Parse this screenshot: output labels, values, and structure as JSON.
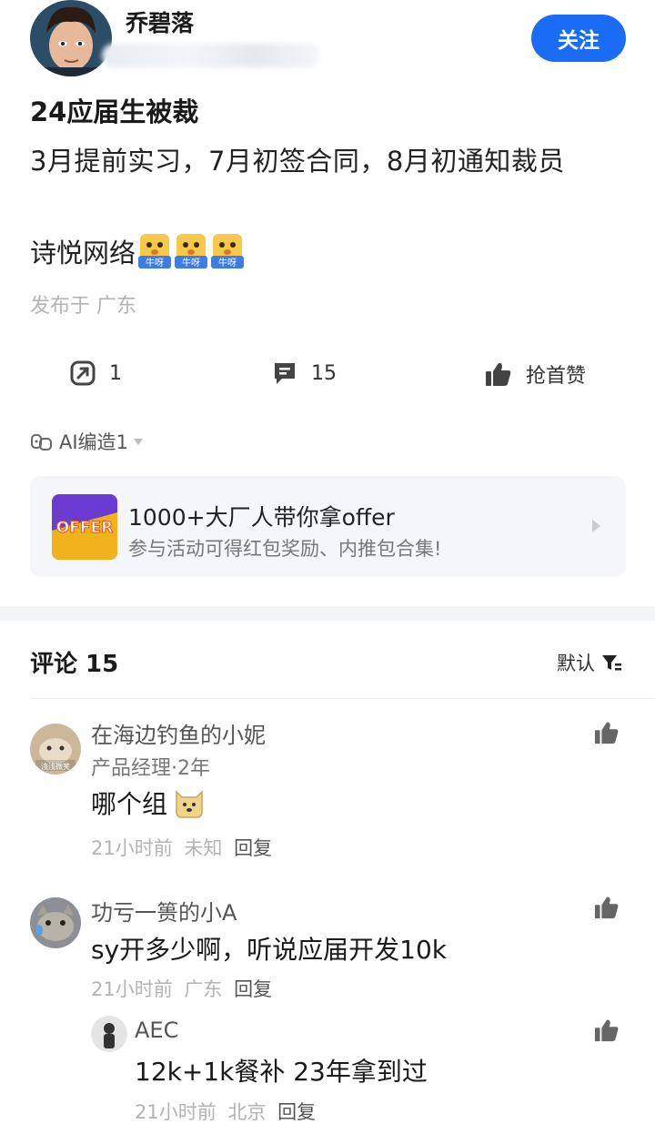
{
  "author": {
    "name": "乔碧落",
    "follow_label": "关注"
  },
  "post": {
    "title": "24应届生被裁",
    "body": "3月提前实习，7月初签合同，8月初通知裁员",
    "extra_text": "诗悦网络",
    "emoji_label": "牛呀",
    "location": "发布于 广东"
  },
  "actions": {
    "share_count": "1",
    "comment_count": "15",
    "like_label": "抢首赞"
  },
  "ai_tag": "AI编造1",
  "promo": {
    "badge": "OFFER",
    "title": "1000+大厂人带你拿offer",
    "subtitle": "参与活动可得红包奖励、内推包合集!"
  },
  "comments_header": {
    "title": "评论 15",
    "sort_label": "默认"
  },
  "comments": [
    {
      "name": "在海边钓鱼的小妮",
      "role": "产品经理·2年",
      "avatar_text": "浅浅微笑",
      "text": "哪个组",
      "time": "21小时前",
      "location": "未知",
      "reply": "回复"
    },
    {
      "name": "功亏一篑的小A",
      "text": "sy开多少啊，听说应届开发10k",
      "time": "21小时前",
      "location": "广东",
      "reply": "回复"
    },
    {
      "name": "AEC",
      "text": "12k+1k餐补 23年拿到过",
      "time": "21小时前",
      "location": "北京",
      "reply": "回复"
    }
  ],
  "colors": {
    "accent": "#1a6cf4",
    "muted": "#b3b3b3"
  }
}
